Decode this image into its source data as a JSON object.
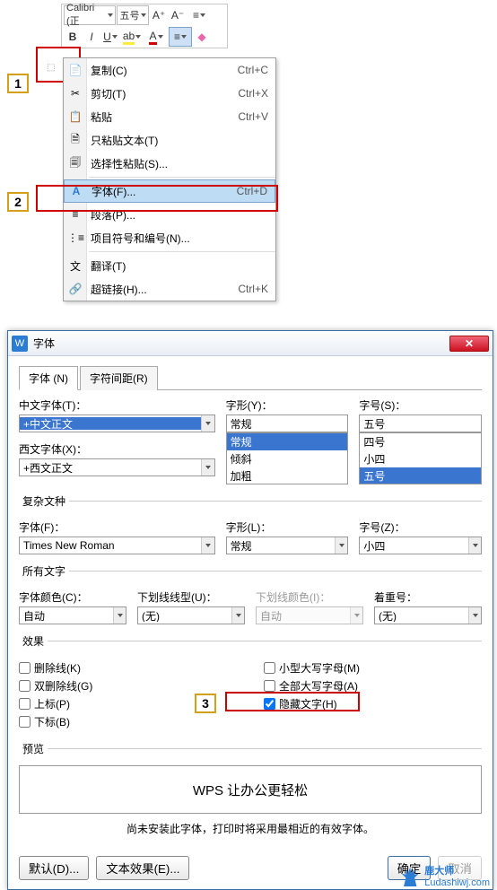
{
  "toolbar": {
    "font_name": "Calibri (正",
    "font_size": "五号",
    "inc_font": "A⁺",
    "dec_font": "A⁻"
  },
  "steps": {
    "s1": "1",
    "s2": "2",
    "s3": "3"
  },
  "context_menu": {
    "copy": {
      "label": "复制(C)",
      "shortcut": "Ctrl+C"
    },
    "cut": {
      "label": "剪切(T)",
      "shortcut": "Ctrl+X"
    },
    "paste": {
      "label": "粘贴",
      "shortcut": "Ctrl+V"
    },
    "paste_text": {
      "label": "只粘贴文本(T)",
      "shortcut": ""
    },
    "paste_special": {
      "label": "选择性粘贴(S)...",
      "shortcut": ""
    },
    "font": {
      "label": "字体(F)...",
      "shortcut": "Ctrl+D"
    },
    "paragraph": {
      "label": "段落(P)...",
      "shortcut": ""
    },
    "bullets": {
      "label": "项目符号和编号(N)...",
      "shortcut": ""
    },
    "translate": {
      "label": "翻译(T)",
      "shortcut": ""
    },
    "hyperlink": {
      "label": "超链接(H)...",
      "shortcut": "Ctrl+K"
    }
  },
  "dialog": {
    "title": "字体",
    "tabs": {
      "font": "字体 (N)",
      "spacing": "字符间距(R)"
    },
    "chinese_font": {
      "label": "中文字体(T)：",
      "value": "+中文正文"
    },
    "style_top": {
      "label": "字形(Y)：",
      "value": "常规",
      "options": [
        "常规",
        "倾斜",
        "加粗"
      ]
    },
    "size_top": {
      "label": "字号(S)：",
      "value": "五号",
      "options": [
        "四号",
        "小四",
        "五号"
      ]
    },
    "western_font": {
      "label": "西文字体(X)：",
      "value": "+西文正文"
    },
    "complex": {
      "legend": "复杂文种",
      "font": {
        "label": "字体(F)：",
        "value": "Times New Roman"
      },
      "style": {
        "label": "字形(L)：",
        "value": "常规"
      },
      "size": {
        "label": "字号(Z)：",
        "value": "小四"
      }
    },
    "all_text": {
      "legend": "所有文字",
      "color": {
        "label": "字体颜色(C)：",
        "value": "自动"
      },
      "underline": {
        "label": "下划线线型(U)：",
        "value": "(无)"
      },
      "underline_color": {
        "label": "下划线颜色(I)：",
        "value": "自动"
      },
      "emphasis": {
        "label": "着重号：",
        "value": "(无)"
      }
    },
    "effects": {
      "legend": "效果",
      "strike": "删除线(K)",
      "dstrike": "双删除线(G)",
      "super": "上标(P)",
      "sub": "下标(B)",
      "smallcaps": "小型大写字母(M)",
      "allcaps": "全部大写字母(A)",
      "hidden": "隐藏文字(H)"
    },
    "preview": {
      "legend": "预览",
      "text": "WPS 让办公更轻松"
    },
    "note": "尚未安装此字体，打印时将采用最相近的有效字体。",
    "buttons": {
      "default": "默认(D)...",
      "effects": "文本效果(E)...",
      "ok": "确定",
      "cancel": "取消"
    }
  },
  "watermark": {
    "name": "鹿大师",
    "url": "Ludashiwj.com"
  }
}
